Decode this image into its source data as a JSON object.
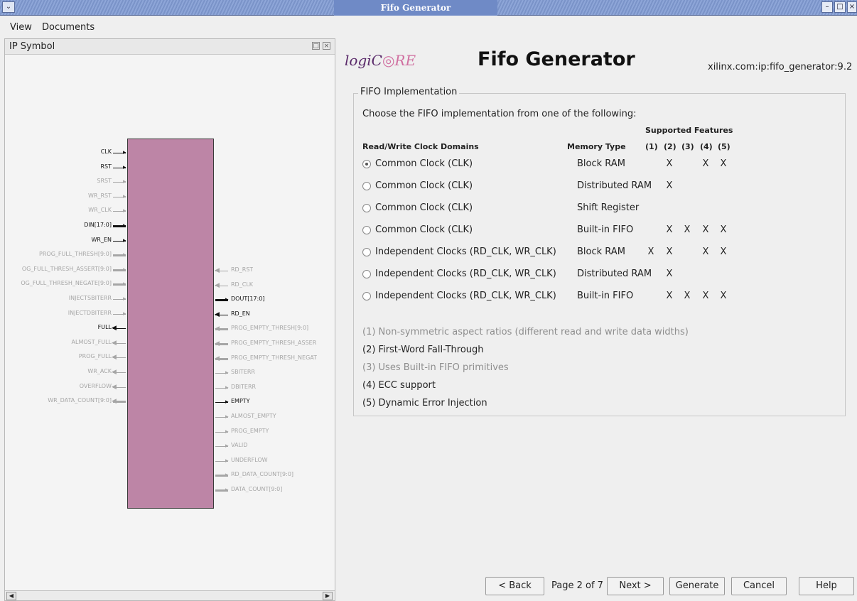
{
  "window": {
    "title": "Fifo Generator"
  },
  "menu": {
    "items": [
      "View",
      "Documents"
    ]
  },
  "left_panel": {
    "title": "IP Symbol",
    "inputs": [
      {
        "label": "CLK",
        "strong": true,
        "bus": false
      },
      {
        "label": "RST",
        "strong": true,
        "bus": false
      },
      {
        "label": "SRST",
        "strong": false,
        "bus": false
      },
      {
        "label": "WR_RST",
        "strong": false,
        "bus": false
      },
      {
        "label": "WR_CLK",
        "strong": false,
        "bus": false
      },
      {
        "label": "DIN[17:0]",
        "strong": true,
        "bus": true
      },
      {
        "label": "WR_EN",
        "strong": true,
        "bus": false
      },
      {
        "label": "PROG_FULL_THRESH[9:0]",
        "strong": false,
        "bus": true
      },
      {
        "label": "OG_FULL_THRESH_ASSERT[9:0]",
        "strong": false,
        "bus": true
      },
      {
        "label": "OG_FULL_THRESH_NEGATE[9:0]",
        "strong": false,
        "bus": true
      },
      {
        "label": "INJECTSBITERR",
        "strong": false,
        "bus": false
      },
      {
        "label": "INJECTDBITERR",
        "strong": false,
        "bus": false
      },
      {
        "label": "FULL",
        "strong": true,
        "bus": false,
        "out": true
      },
      {
        "label": "ALMOST_FULL",
        "strong": false,
        "bus": false,
        "out": true
      },
      {
        "label": "PROG_FULL",
        "strong": false,
        "bus": false,
        "out": true
      },
      {
        "label": "WR_ACK",
        "strong": false,
        "bus": false,
        "out": true
      },
      {
        "label": "OVERFLOW",
        "strong": false,
        "bus": false,
        "out": true
      },
      {
        "label": "WR_DATA_COUNT[9:0]",
        "strong": false,
        "bus": true,
        "out": true
      }
    ],
    "outputs": [
      {
        "label": "RD_RST",
        "strong": false,
        "bus": false,
        "in": true
      },
      {
        "label": "RD_CLK",
        "strong": false,
        "bus": false,
        "in": true
      },
      {
        "label": "DOUT[17:0]",
        "strong": true,
        "bus": true
      },
      {
        "label": "RD_EN",
        "strong": true,
        "bus": false,
        "in": true
      },
      {
        "label": "PROG_EMPTY_THRESH[9:0]",
        "strong": false,
        "bus": true,
        "in": true
      },
      {
        "label": "PROG_EMPTY_THRESH_ASSER",
        "strong": false,
        "bus": true,
        "in": true
      },
      {
        "label": "PROG_EMPTY_THRESH_NEGAT",
        "strong": false,
        "bus": true,
        "in": true
      },
      {
        "label": "SBITERR",
        "strong": false,
        "bus": false
      },
      {
        "label": "DBITERR",
        "strong": false,
        "bus": false
      },
      {
        "label": "EMPTY",
        "strong": true,
        "bus": false
      },
      {
        "label": "ALMOST_EMPTY",
        "strong": false,
        "bus": false
      },
      {
        "label": "PROG_EMPTY",
        "strong": false,
        "bus": false
      },
      {
        "label": "VALID",
        "strong": false,
        "bus": false
      },
      {
        "label": "UNDERFLOW",
        "strong": false,
        "bus": false
      },
      {
        "label": "RD_DATA_COUNT[9:0]",
        "strong": false,
        "bus": true
      },
      {
        "label": "DATA_COUNT[9:0]",
        "strong": false,
        "bus": true
      }
    ]
  },
  "header": {
    "logo_prefix": "logiC",
    "logo_suffix": "RE",
    "title": "Fifo Generator",
    "vlnv": "xilinx.com:ip:fifo_generator:9.2"
  },
  "group": {
    "title": "FIFO Implementation",
    "instruction": "Choose the FIFO implementation from one of the following:",
    "supported_header": "Supported Features",
    "col_domains": "Read/Write Clock Domains",
    "col_memory": "Memory Type",
    "feature_cols": [
      "(1)",
      "(2)",
      "(3)",
      "(4)",
      "(5)"
    ],
    "rows": [
      {
        "label": "Common Clock (CLK)",
        "memory": "Block RAM",
        "selected": true,
        "features": [
          "",
          "X",
          "",
          "X",
          "X"
        ]
      },
      {
        "label": "Common Clock (CLK)",
        "memory": "Distributed RAM",
        "selected": false,
        "features": [
          "",
          "X",
          "",
          "",
          ""
        ]
      },
      {
        "label": "Common Clock (CLK)",
        "memory": "Shift Register",
        "selected": false,
        "features": [
          "",
          "",
          "",
          "",
          ""
        ]
      },
      {
        "label": "Common Clock (CLK)",
        "memory": "Built-in FIFO",
        "selected": false,
        "features": [
          "",
          "X",
          "X",
          "X",
          "X"
        ]
      },
      {
        "label": "Independent Clocks (RD_CLK, WR_CLK)",
        "memory": "Block RAM",
        "selected": false,
        "features": [
          "X",
          "X",
          "",
          "X",
          "X"
        ]
      },
      {
        "label": "Independent Clocks (RD_CLK, WR_CLK)",
        "memory": "Distributed RAM",
        "selected": false,
        "features": [
          "",
          "X",
          "",
          "",
          ""
        ]
      },
      {
        "label": "Independent Clocks (RD_CLK, WR_CLK)",
        "memory": "Built-in FIFO",
        "selected": false,
        "features": [
          "",
          "X",
          "X",
          "X",
          "X"
        ]
      }
    ],
    "notes": [
      {
        "text": "(1) Non-symmetric aspect ratios (different read and write data widths)",
        "dim": true
      },
      {
        "text": "(2) First-Word Fall-Through",
        "dim": false
      },
      {
        "text": "(3) Uses Built-in FIFO primitives",
        "dim": true
      },
      {
        "text": "(4) ECC support",
        "dim": false
      },
      {
        "text": "(5) Dynamic Error Injection",
        "dim": false
      }
    ]
  },
  "footer": {
    "back": "< Back",
    "page": "Page 2 of 7",
    "next": "Next >",
    "generate": "Generate",
    "cancel": "Cancel",
    "help": "Help"
  }
}
